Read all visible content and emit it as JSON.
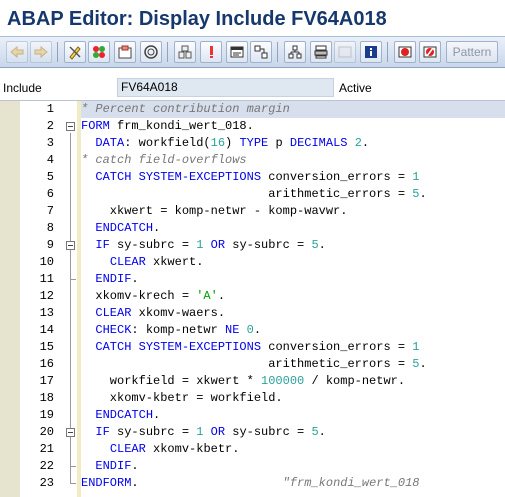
{
  "window": {
    "title": "ABAP Editor: Display Include FV64A018"
  },
  "toolbar": {
    "buttons": [
      {
        "name": "back-arrow-icon"
      },
      {
        "name": "forward-arrow-icon"
      },
      {
        "name": "display-change-icon"
      },
      {
        "name": "active-inactive-icon"
      },
      {
        "name": "other-object-icon"
      },
      {
        "name": "check-icon"
      },
      {
        "name": "activate-icon"
      },
      {
        "name": "test-icon"
      },
      {
        "name": "where-used-icon"
      },
      {
        "name": "object-list-icon"
      },
      {
        "name": "navigation-icon"
      },
      {
        "name": "hierarchy-icon"
      },
      {
        "name": "printer-icon"
      },
      {
        "name": "disabled-icon"
      },
      {
        "name": "info-icon"
      },
      {
        "name": "set-breakpoint-icon"
      },
      {
        "name": "session-breakpoint-icon"
      }
    ],
    "pattern_label": "Pattern"
  },
  "info": {
    "include_label": "Include",
    "include_value": "FV64A018",
    "status": "Active"
  },
  "editor": {
    "lines": [
      {
        "n": "1",
        "html": "<span class=\"cm\">* Percent contribution margin</span>"
      },
      {
        "n": "2",
        "html": "<span class=\"kw\">FORM</span> frm_kondi_wert_018."
      },
      {
        "n": "3",
        "html": "  <span class=\"kw\">DATA</span>: workfield(<span class=\"num\">16</span>) <span class=\"kw\">TYPE</span> p <span class=\"kw\">DECIMALS</span> <span class=\"num\">2</span>."
      },
      {
        "n": "4",
        "html": "<span class=\"cm\">* catch field-overflows</span>"
      },
      {
        "n": "5",
        "html": "  <span class=\"kw\">CATCH SYSTEM-EXCEPTIONS</span> conversion_errors = <span class=\"num\">1</span>"
      },
      {
        "n": "6",
        "html": "                          arithmetic_errors = <span class=\"num\">5</span>."
      },
      {
        "n": "7",
        "html": "    xkwert = komp-netwr - komp-wavwr."
      },
      {
        "n": "8",
        "html": "  <span class=\"kw\">ENDCATCH</span>."
      },
      {
        "n": "9",
        "html": "  <span class=\"kw\">IF</span> sy-subrc = <span class=\"num\">1</span> <span class=\"kw\">OR</span> sy-subrc = <span class=\"num\">5</span>."
      },
      {
        "n": "10",
        "html": "    <span class=\"kw\">CLEAR</span> xkwert."
      },
      {
        "n": "11",
        "html": "  <span class=\"kw\">ENDIF</span>."
      },
      {
        "n": "12",
        "html": "  xkomv-krech = <span class=\"str\">'A'</span>."
      },
      {
        "n": "13",
        "html": "  <span class=\"kw\">CLEAR</span> xkomv-waers."
      },
      {
        "n": "14",
        "html": "  <span class=\"kw\">CHECK</span>: komp-netwr <span class=\"kw\">NE</span> <span class=\"num\">0</span>."
      },
      {
        "n": "15",
        "html": "  <span class=\"kw\">CATCH SYSTEM-EXCEPTIONS</span> conversion_errors = <span class=\"num\">1</span>"
      },
      {
        "n": "16",
        "html": "                          arithmetic_errors = <span class=\"num\">5</span>."
      },
      {
        "n": "17",
        "html": "    workfield = xkwert * <span class=\"num\">100000</span> / komp-netwr."
      },
      {
        "n": "18",
        "html": "    xkomv-kbetr = workfield."
      },
      {
        "n": "19",
        "html": "  <span class=\"kw\">ENDCATCH</span>."
      },
      {
        "n": "20",
        "html": "  <span class=\"kw\">IF</span> sy-subrc = <span class=\"num\">1</span> <span class=\"kw\">OR</span> sy-subrc = <span class=\"num\">5</span>."
      },
      {
        "n": "21",
        "html": "    <span class=\"kw\">CLEAR</span> xkomv-kbetr."
      },
      {
        "n": "22",
        "html": "  <span class=\"kw\">ENDIF</span>."
      },
      {
        "n": "23",
        "html": "<span class=\"kw\">ENDFORM</span>.                    <span class=\"cm\">\"frm_kondi_wert_018</span>"
      }
    ]
  }
}
